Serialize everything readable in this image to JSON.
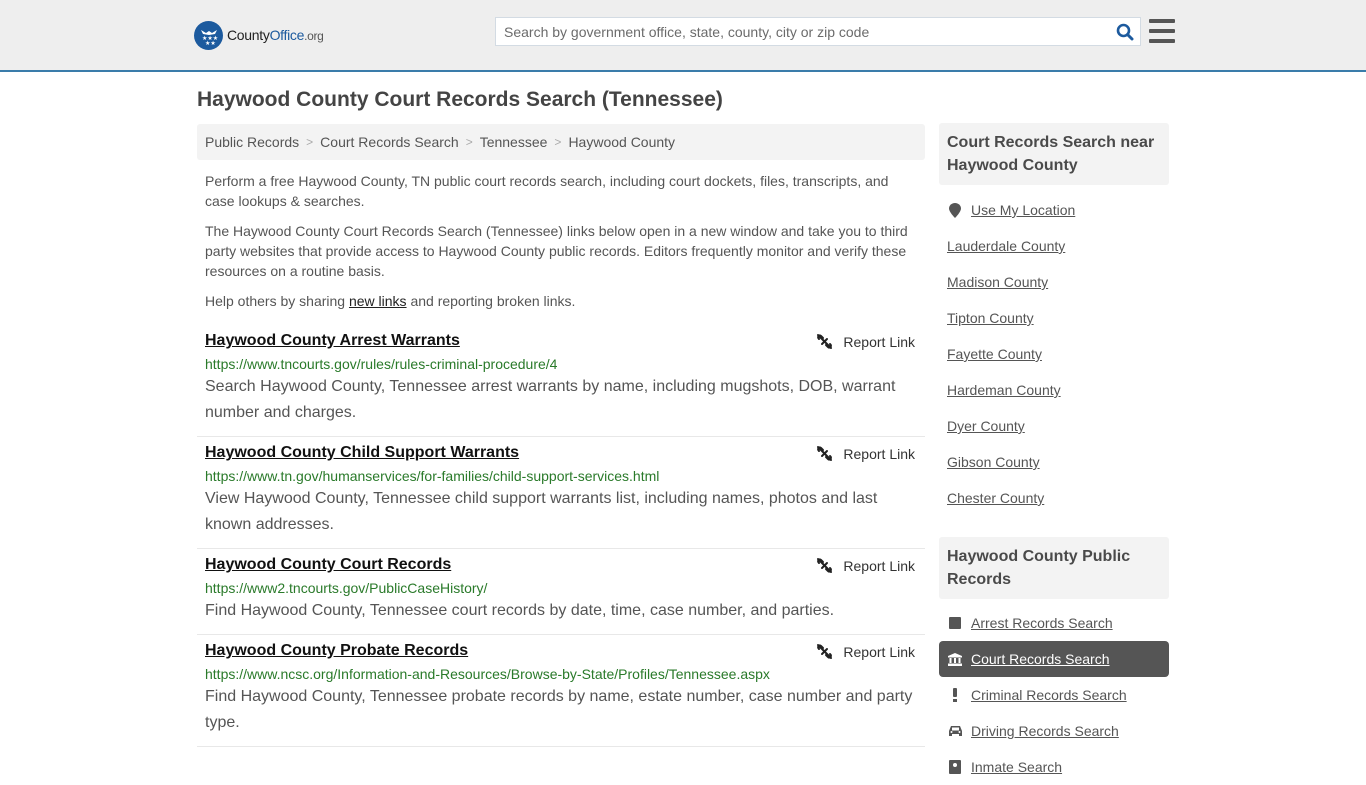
{
  "header": {
    "logo": {
      "prefix": "County",
      "brand": "Office",
      "tld": ".org"
    },
    "search": {
      "placeholder": "Search by government office, state, county, city or zip code",
      "value": ""
    },
    "icons": {
      "search": "search-icon",
      "menu": "hamburger-menu-icon",
      "logo": "eagle-stars-logo-icon"
    },
    "colors": {
      "brand": "#1c5a9e",
      "accent_border": "#3a7caa"
    }
  },
  "page": {
    "title": "Haywood County Court Records Search (Tennessee)",
    "breadcrumb": [
      "Public Records",
      "Court Records Search",
      "Tennessee",
      "Haywood County"
    ],
    "intro": {
      "p1": "Perform a free Haywood County, TN public court records search, including court dockets, files, transcripts, and case lookups & searches.",
      "p2": "The Haywood County Court Records Search (Tennessee) links below open in a new window and take you to third party websites that provide access to Haywood County public records. Editors frequently monitor and verify these resources on a routine basis.",
      "p3_before": "Help others by sharing ",
      "p3_link": "new links",
      "p3_after": " and reporting broken links."
    },
    "report_label": "Report Link",
    "results": [
      {
        "title": "Haywood County Arrest Warrants",
        "url": "https://www.tncourts.gov/rules/rules-criminal-procedure/4",
        "description": "Search Haywood County, Tennessee arrest warrants by name, including mugshots, DOB, warrant number and charges."
      },
      {
        "title": "Haywood County Child Support Warrants",
        "url": "https://www.tn.gov/humanservices/for-families/child-support-services.html",
        "description": "View Haywood County, Tennessee child support warrants list, including names, photos and last known addresses."
      },
      {
        "title": "Haywood County Court Records",
        "url": "https://www2.tncourts.gov/PublicCaseHistory/",
        "description": "Find Haywood County, Tennessee court records by date, time, case number, and parties."
      },
      {
        "title": "Haywood County Probate Records",
        "url": "https://www.ncsc.org/Information-and-Resources/Browse-by-State/Profiles/Tennessee.aspx",
        "description": "Find Haywood County, Tennessee probate records by name, estate number, case number and party type."
      }
    ]
  },
  "sidebar": {
    "nearby": {
      "heading": "Court Records Search near Haywood County",
      "use_location": "Use My Location",
      "counties": [
        "Lauderdale County",
        "Madison County",
        "Tipton County",
        "Fayette County",
        "Hardeman County",
        "Dyer County",
        "Gibson County",
        "Chester County"
      ]
    },
    "public_records": {
      "heading": "Haywood County Public Records",
      "items": [
        {
          "label": "Arrest Records Search",
          "icon": "square-icon",
          "active": false
        },
        {
          "label": "Court Records Search",
          "icon": "courthouse-icon",
          "active": true
        },
        {
          "label": "Criminal Records Search",
          "icon": "exclamation-icon",
          "active": false
        },
        {
          "label": "Driving Records Search",
          "icon": "car-icon",
          "active": false
        },
        {
          "label": "Inmate Search",
          "icon": "inmate-icon",
          "active": false
        }
      ]
    }
  }
}
